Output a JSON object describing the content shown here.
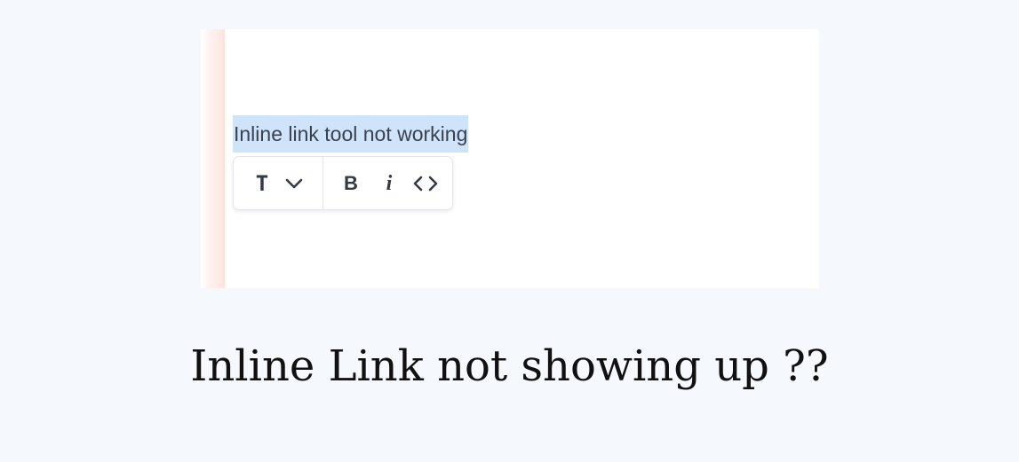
{
  "editor": {
    "selected_text": "Inline link tool not working"
  },
  "toolbar": {
    "text_style_label": "T",
    "bold_label": "B",
    "italic_label": "i",
    "code_label": "<>"
  },
  "icons": [
    "text-style-icon",
    "chevron-down-icon",
    "bold-icon",
    "italic-icon",
    "code-icon"
  ],
  "caption": "Inline Link not showing up ??"
}
